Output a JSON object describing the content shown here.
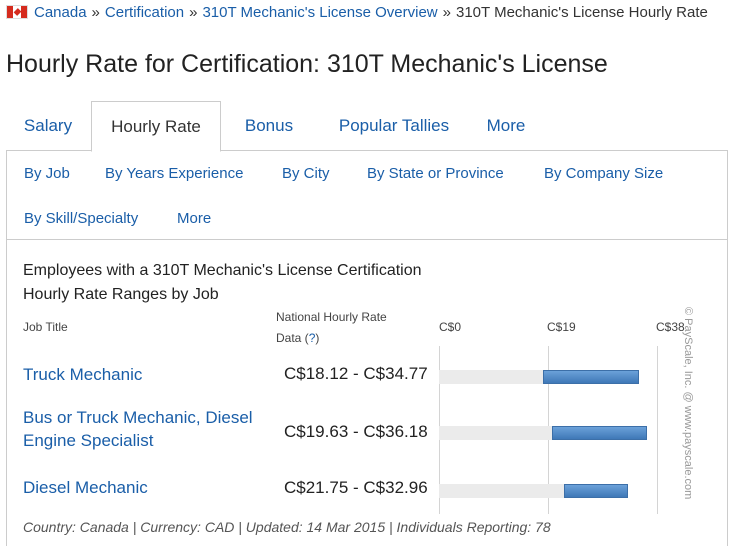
{
  "breadcrumb": {
    "items": [
      "Canada",
      "Certification",
      "310T Mechanic's License Overview"
    ],
    "current": "310T Mechanic's License Hourly Rate",
    "separator": "»"
  },
  "page_title": "Hourly Rate for Certification: 310T Mechanic's License",
  "tabs": [
    {
      "label": "Salary",
      "active": false
    },
    {
      "label": "Hourly Rate",
      "active": true
    },
    {
      "label": "Bonus",
      "active": false
    },
    {
      "label": "Popular Tallies",
      "active": false
    },
    {
      "label": "More",
      "active": false
    }
  ],
  "subnav": [
    "By Job",
    "By Years Experience",
    "By City",
    "By State or Province",
    "By Company Size",
    "By Skill/Specialty",
    "More"
  ],
  "chart": {
    "heading_line1": "Employees with a 310T Mechanic's License Certification",
    "heading_line2": "Hourly Rate Ranges by Job",
    "col_job_title": "Job Title",
    "col_rate_line1": "National Hourly Rate",
    "col_rate_line2": "Data (",
    "col_rate_help": "?",
    "col_rate_close": ")",
    "axis_ticks": [
      "C$0",
      "C$19",
      "C$38"
    ]
  },
  "chart_data": {
    "type": "bar",
    "orientation": "horizontal-range",
    "x_min": 0,
    "x_max": 38,
    "rows": [
      {
        "title": "Truck Mechanic",
        "range_label": "C$18.12 - C$34.77",
        "low": 18.12,
        "high": 34.77
      },
      {
        "title": "Bus or Truck Mechanic, Diesel Engine Specialist",
        "range_label": "C$19.63 - C$36.18",
        "low": 19.63,
        "high": 36.18
      },
      {
        "title": "Diesel Mechanic",
        "range_label": "C$21.75 - C$32.96",
        "low": 21.75,
        "high": 32.96
      }
    ]
  },
  "footer_note": "Country: Canada | Currency: CAD | Updated: 14 Mar 2015 | Individuals Reporting: 78",
  "watermark": "© PayScale, Inc. @ www.payscale.com",
  "colors": {
    "link": "#1a5ea8",
    "bar": "#4a82c0",
    "track": "#ebebeb",
    "flag_red": "#d52b1e"
  }
}
